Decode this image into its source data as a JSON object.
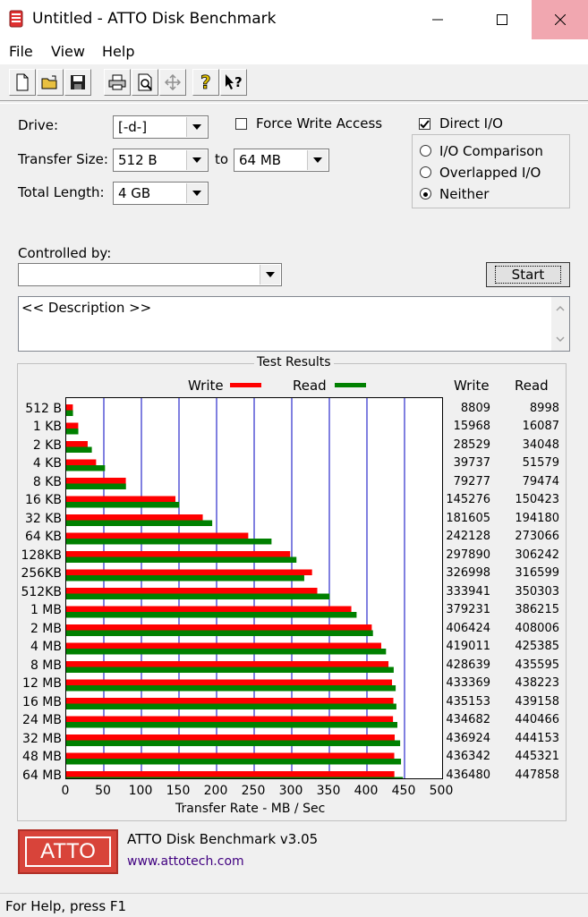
{
  "window": {
    "title": "Untitled - ATTO Disk Benchmark"
  },
  "menu": [
    "File",
    "View",
    "Help"
  ],
  "toolbar": {
    "icons": [
      "new-icon",
      "open-icon",
      "save-icon",
      "print-icon",
      "print-preview-icon",
      "move-icon",
      "help-icon",
      "context-help-icon"
    ]
  },
  "form": {
    "drive_label": "Drive:",
    "drive_value": "[-d-]",
    "transfer_label": "Transfer Size:",
    "transfer_from": "512 B",
    "to_label": "to",
    "transfer_to": "64 MB",
    "length_label": "Total Length:",
    "length_value": "4 GB",
    "force_write_label": "Force Write Access",
    "force_write_checked": false,
    "direct_io_label": "Direct I/O",
    "direct_io_checked": true,
    "radio_options": [
      "I/O Comparison",
      "Overlapped I/O",
      "Neither"
    ],
    "radio_selected": "Neither",
    "controlled_label": "Controlled by:",
    "controlled_value": "",
    "start_label": "Start",
    "description": "<< Description >>"
  },
  "results": {
    "title": "Test Results",
    "legend_write": "Write",
    "legend_read": "Read",
    "col_write": "Write",
    "col_read": "Read",
    "xlabel": "Transfer Rate - MB / Sec",
    "colors": {
      "write": "#ff0000",
      "read": "#008000",
      "grid": "#0000c0"
    }
  },
  "chart_data": {
    "type": "bar",
    "orientation": "horizontal",
    "categories": [
      "512 B",
      "1 KB",
      "2 KB",
      "4 KB",
      "8 KB",
      "16 KB",
      "32 KB",
      "64 KB",
      "128KB",
      "256KB",
      "512KB",
      "1 MB",
      "2 MB",
      "4 MB",
      "8 MB",
      "12 MB",
      "16 MB",
      "24 MB",
      "32 MB",
      "48 MB",
      "64 MB"
    ],
    "series": [
      {
        "name": "Write",
        "values": [
          8809,
          15968,
          28529,
          39737,
          79277,
          145276,
          181605,
          242128,
          297890,
          326998,
          333941,
          379231,
          406424,
          419011,
          428639,
          433369,
          435153,
          434682,
          436924,
          436342,
          436480
        ]
      },
      {
        "name": "Read",
        "values": [
          8998,
          16087,
          34048,
          51579,
          79474,
          150423,
          194180,
          273066,
          306242,
          316599,
          350303,
          386215,
          408006,
          425385,
          435595,
          438223,
          439158,
          440466,
          444153,
          445321,
          447858
        ]
      }
    ],
    "xlabel": "Transfer Rate - MB / Sec",
    "xlim": [
      0,
      500
    ],
    "xticks": [
      0,
      50,
      100,
      150,
      200,
      250,
      300,
      350,
      400,
      450,
      500
    ],
    "grid": true,
    "legend": "top"
  },
  "brand": {
    "logo": "ATTO",
    "version": "ATTO Disk Benchmark v3.05",
    "url": "www.attotech.com"
  },
  "status": "For Help, press F1"
}
